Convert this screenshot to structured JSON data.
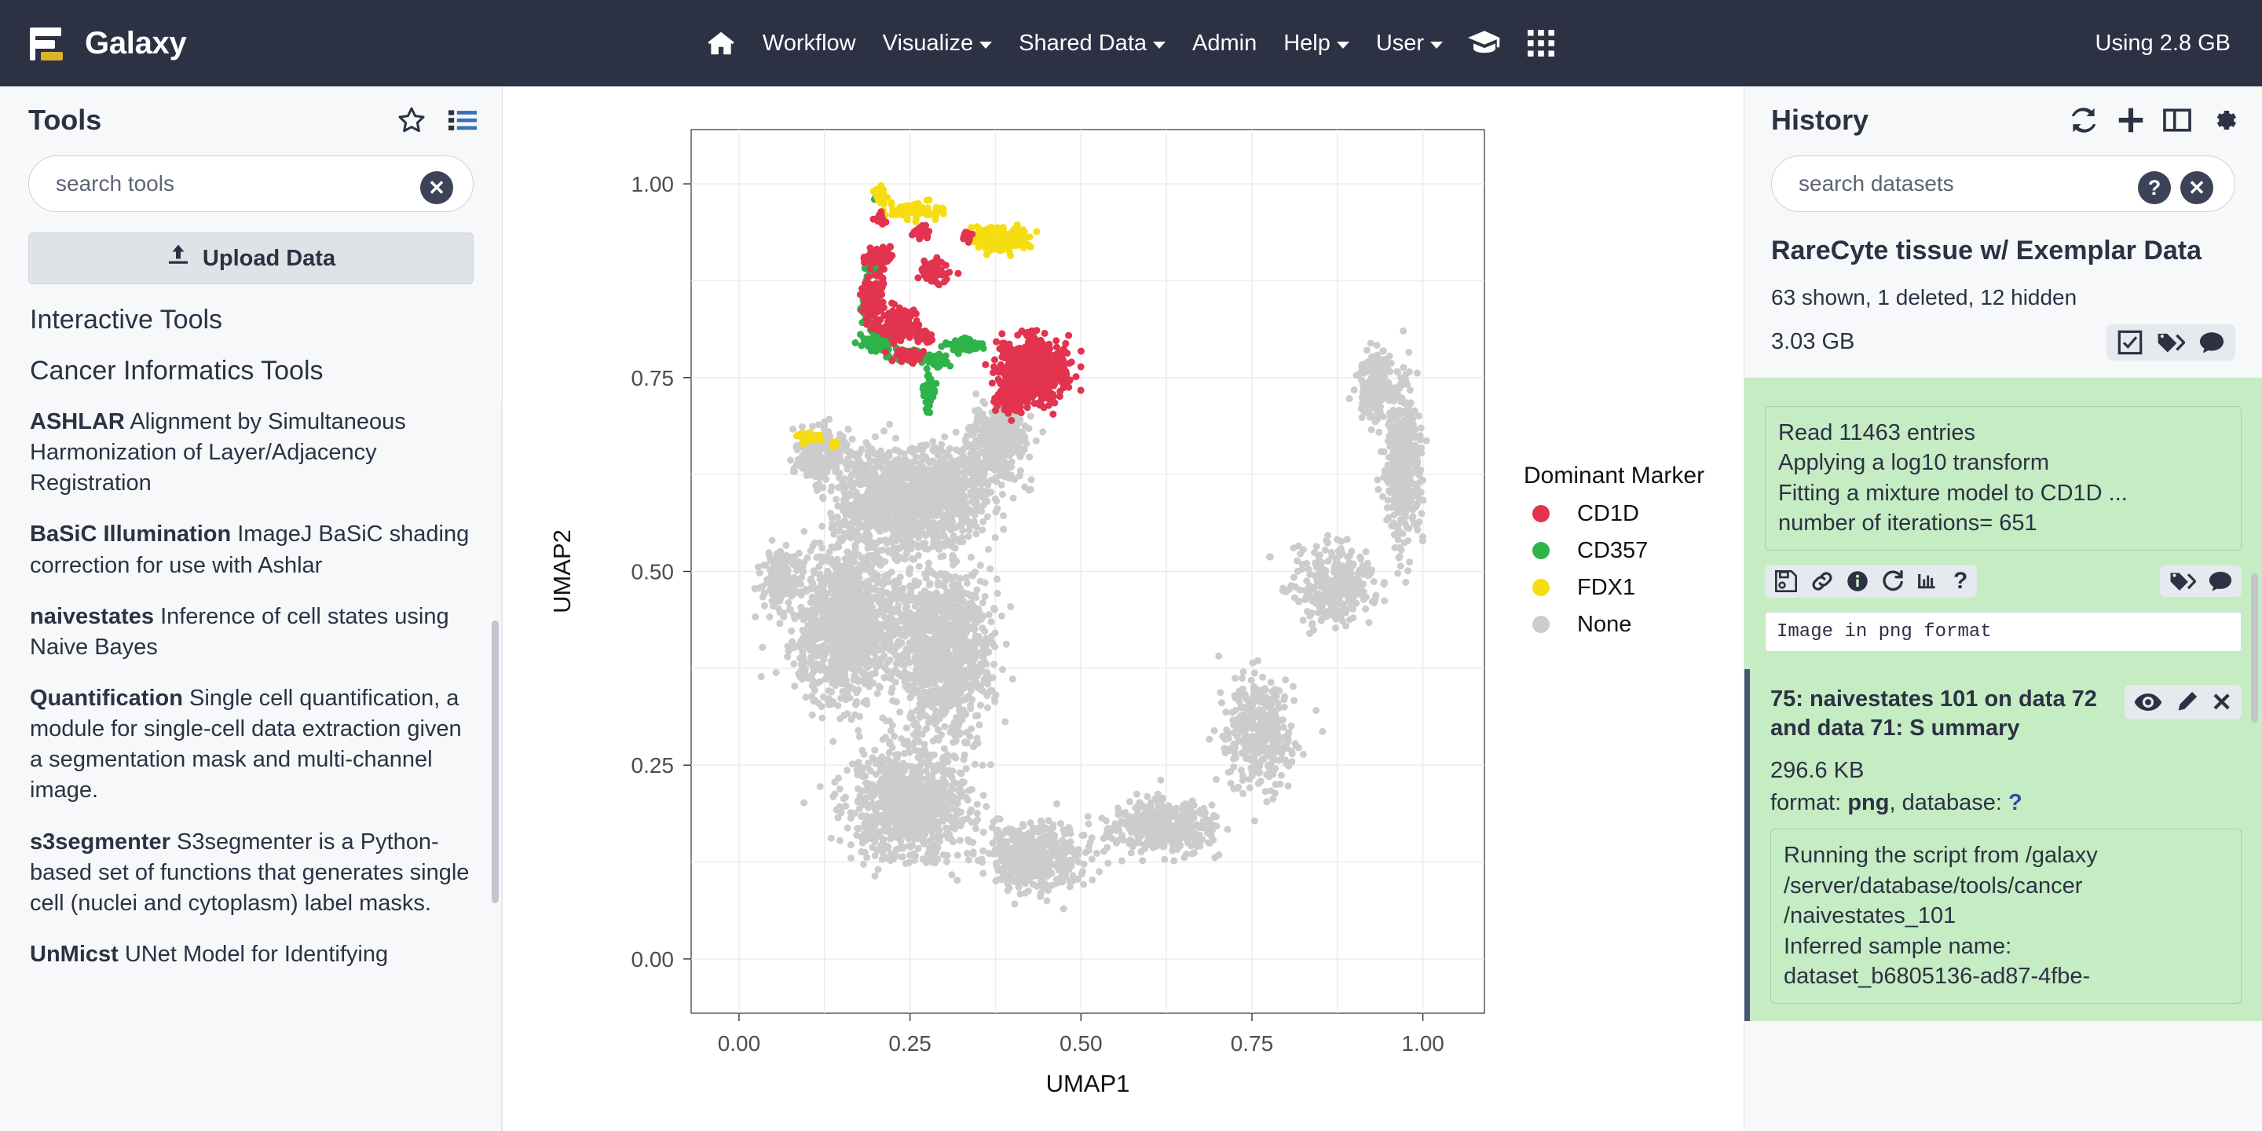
{
  "masthead": {
    "brand": "Galaxy",
    "nav": [
      {
        "name": "home",
        "label": "",
        "icon": "home-icon",
        "caret": false
      },
      {
        "name": "workflow",
        "label": "Workflow",
        "caret": false
      },
      {
        "name": "visualize",
        "label": "Visualize",
        "caret": true
      },
      {
        "name": "shared-data",
        "label": "Shared Data",
        "caret": true
      },
      {
        "name": "admin",
        "label": "Admin",
        "caret": false
      },
      {
        "name": "help",
        "label": "Help",
        "caret": true
      },
      {
        "name": "user",
        "label": "User",
        "caret": true
      }
    ],
    "icons": [
      "graduation-cap-icon",
      "grid-apps-icon"
    ],
    "quota": "Using 2.8 GB"
  },
  "tools": {
    "title": "Tools",
    "favorites_icon": "star-icon",
    "list_icon": "list-icon",
    "search_placeholder": "search tools",
    "search_value": "",
    "clear_icon": "clear-x-icon",
    "upload_label": "Upload Data",
    "upload_icon": "upload-icon",
    "sections": [
      {
        "label": "Interactive Tools"
      },
      {
        "label": "Cancer Informatics Tools"
      }
    ],
    "entries": [
      {
        "name": "ASHLAR",
        "desc": "Alignment by Simultaneous Harmonization of Layer/Adjacency Registration"
      },
      {
        "name": "BaSiC Illumination",
        "desc": "ImageJ BaSiC shading correction for use with Ashlar"
      },
      {
        "name": "naivestates",
        "desc": "Inference of cell states using Naive Bayes"
      },
      {
        "name": "Quantification",
        "desc": "Single cell quantification, a module for single-cell data extraction given a segmentation mask and multi-channel image."
      },
      {
        "name": "s3segmenter",
        "desc": "S3segmenter is a Python-based set of functions that generates single cell (nuclei and cytoplasm) label masks."
      },
      {
        "name": "UnMicst",
        "desc": "UNet Model for Identifying"
      }
    ]
  },
  "history": {
    "title": "History",
    "icons": [
      "refresh-icon",
      "plus-icon",
      "columns-icon",
      "gear-icon"
    ],
    "search_placeholder": "search datasets",
    "search_value": "",
    "help_icon": "help-icon",
    "clear_icon": "clear-x-icon",
    "name": "RareCyte tissue w/ Exemplar Data",
    "counts": "63 shown, 1 deleted, 12 hidden",
    "size": "3.03 GB",
    "toolbar_icons": [
      "select-checkbox-icon",
      "tags-icon",
      "comment-icon"
    ],
    "datasets": [
      {
        "peek_lines": [
          "Read 11463 entries",
          "Applying a log10 transform",
          "Fitting a mixture model to CD1D ...",
          "number of iterations= 651"
        ],
        "action_icons": [
          "save-icon",
          "link-icon",
          "info-icon",
          "rerun-icon",
          "visualize-icon",
          "help-icon"
        ],
        "meta_icons": [
          "tags-icon",
          "comment-icon"
        ],
        "blurb": "Image in png format"
      },
      {
        "title": "75: naivestates 101 on data 72 and data 71: S ummary",
        "action_icons": [
          "eye-icon",
          "pencil-icon",
          "delete-x-icon"
        ],
        "size": "296.6 KB",
        "format_label": "format:",
        "format_value": "png",
        "database_label": ", database:",
        "database_value": "?",
        "peek_lines": [
          "Running the script from /galaxy",
          "/server/database/tools/cancer",
          "/naivestates_101",
          "Inferred sample name:",
          "dataset_b6805136-ad87-4fbe-"
        ]
      }
    ]
  },
  "chart_data": {
    "type": "scatter",
    "title": "",
    "xlabel": "UMAP1",
    "ylabel": "UMAP2",
    "xlim": [
      -0.07,
      1.09
    ],
    "ylim": [
      -0.07,
      1.07
    ],
    "xticks": [
      "0.00",
      "0.25",
      "0.50",
      "0.75",
      "1.00"
    ],
    "xtick_values": [
      0.0,
      0.25,
      0.5,
      0.75,
      1.0
    ],
    "yticks": [
      "0.00",
      "0.25",
      "0.50",
      "0.75",
      "1.00"
    ],
    "ytick_values": [
      0.0,
      0.25,
      0.5,
      0.75,
      1.0
    ],
    "grid": true,
    "legend_title": "Dominant Marker",
    "legend_position": "right",
    "series": [
      {
        "name": "CD1D",
        "color": "#e2334f",
        "n": 1720
      },
      {
        "name": "CD357",
        "color": "#2eb34a",
        "n": 690
      },
      {
        "name": "FDX1",
        "color": "#f6dd11",
        "n": 320
      },
      {
        "name": "None",
        "color": "#cccccc",
        "n": 8733
      }
    ],
    "point_size": 9,
    "clusters": [
      {
        "series": "FDX1",
        "cx": 0.205,
        "cy": 0.985,
        "rx": 0.012,
        "ry": 0.012,
        "n": 25
      },
      {
        "series": "FDX1",
        "cx": 0.255,
        "cy": 0.965,
        "rx": 0.05,
        "ry": 0.012,
        "n": 90
      },
      {
        "series": "FDX1",
        "cx": 0.382,
        "cy": 0.93,
        "rx": 0.052,
        "ry": 0.02,
        "n": 150
      },
      {
        "series": "FDX1",
        "cx": 0.106,
        "cy": 0.672,
        "rx": 0.02,
        "ry": 0.007,
        "n": 35
      },
      {
        "series": "FDX1",
        "cx": 0.14,
        "cy": 0.664,
        "rx": 0.007,
        "ry": 0.005,
        "n": 8
      },
      {
        "series": "CD1D",
        "cx": 0.206,
        "cy": 0.955,
        "rx": 0.01,
        "ry": 0.01,
        "n": 18
      },
      {
        "series": "CD1D",
        "cx": 0.268,
        "cy": 0.938,
        "rx": 0.016,
        "ry": 0.008,
        "n": 30
      },
      {
        "series": "CD1D",
        "cx": 0.334,
        "cy": 0.934,
        "rx": 0.01,
        "ry": 0.008,
        "n": 18
      },
      {
        "series": "CD1D",
        "cx": 0.205,
        "cy": 0.905,
        "rx": 0.024,
        "ry": 0.014,
        "n": 60
      },
      {
        "series": "CD1D",
        "cx": 0.285,
        "cy": 0.888,
        "rx": 0.024,
        "ry": 0.018,
        "n": 70
      },
      {
        "series": "CD1D",
        "cx": 0.196,
        "cy": 0.852,
        "rx": 0.02,
        "ry": 0.035,
        "n": 120
      },
      {
        "series": "CD1D",
        "cx": 0.235,
        "cy": 0.818,
        "rx": 0.032,
        "ry": 0.022,
        "n": 160
      },
      {
        "series": "CD1D",
        "cx": 0.27,
        "cy": 0.805,
        "rx": 0.016,
        "ry": 0.012,
        "n": 50
      },
      {
        "series": "CD1D",
        "cx": 0.248,
        "cy": 0.777,
        "rx": 0.022,
        "ry": 0.01,
        "n": 45
      },
      {
        "series": "CD1D",
        "cx": 0.43,
        "cy": 0.762,
        "rx": 0.056,
        "ry": 0.046,
        "n": 700
      },
      {
        "series": "CD1D",
        "cx": 0.395,
        "cy": 0.723,
        "rx": 0.022,
        "ry": 0.024,
        "n": 120
      },
      {
        "series": "CD357",
        "cx": 0.195,
        "cy": 0.893,
        "rx": 0.01,
        "ry": 0.014,
        "n": 28
      },
      {
        "series": "CD357",
        "cx": 0.19,
        "cy": 0.845,
        "rx": 0.012,
        "ry": 0.03,
        "n": 80
      },
      {
        "series": "CD357",
        "cx": 0.202,
        "cy": 0.795,
        "rx": 0.026,
        "ry": 0.013,
        "n": 80
      },
      {
        "series": "CD357",
        "cx": 0.25,
        "cy": 0.778,
        "rx": 0.03,
        "ry": 0.008,
        "n": 70
      },
      {
        "series": "CD357",
        "cx": 0.29,
        "cy": 0.772,
        "rx": 0.02,
        "ry": 0.01,
        "n": 50
      },
      {
        "series": "CD357",
        "cx": 0.33,
        "cy": 0.792,
        "rx": 0.028,
        "ry": 0.01,
        "n": 70
      },
      {
        "series": "CD357",
        "cx": 0.276,
        "cy": 0.73,
        "rx": 0.008,
        "ry": 0.03,
        "n": 60
      },
      {
        "series": "CD357",
        "cx": 0.205,
        "cy": 0.985,
        "rx": 0.008,
        "ry": 0.008,
        "n": 12
      },
      {
        "series": "None",
        "cx": 0.21,
        "cy": 0.59,
        "rx": 0.09,
        "ry": 0.08,
        "n": 700
      },
      {
        "series": "None",
        "cx": 0.16,
        "cy": 0.43,
        "rx": 0.09,
        "ry": 0.11,
        "n": 1200
      },
      {
        "series": "None",
        "cx": 0.3,
        "cy": 0.4,
        "rx": 0.08,
        "ry": 0.13,
        "n": 1100
      },
      {
        "series": "None",
        "cx": 0.3,
        "cy": 0.6,
        "rx": 0.08,
        "ry": 0.07,
        "n": 600
      },
      {
        "series": "None",
        "cx": 0.38,
        "cy": 0.67,
        "rx": 0.05,
        "ry": 0.06,
        "n": 350
      },
      {
        "series": "None",
        "cx": 0.25,
        "cy": 0.2,
        "rx": 0.11,
        "ry": 0.08,
        "n": 900
      },
      {
        "series": "None",
        "cx": 0.43,
        "cy": 0.13,
        "rx": 0.09,
        "ry": 0.05,
        "n": 450
      },
      {
        "series": "None",
        "cx": 0.62,
        "cy": 0.17,
        "rx": 0.09,
        "ry": 0.04,
        "n": 400
      },
      {
        "series": "None",
        "cx": 0.76,
        "cy": 0.29,
        "rx": 0.06,
        "ry": 0.09,
        "n": 380
      },
      {
        "series": "None",
        "cx": 0.87,
        "cy": 0.48,
        "rx": 0.07,
        "ry": 0.06,
        "n": 300
      },
      {
        "series": "None",
        "cx": 0.97,
        "cy": 0.64,
        "rx": 0.03,
        "ry": 0.12,
        "n": 420
      },
      {
        "series": "None",
        "cx": 0.93,
        "cy": 0.74,
        "rx": 0.03,
        "ry": 0.06,
        "n": 180
      },
      {
        "series": "None",
        "cx": 0.06,
        "cy": 0.49,
        "rx": 0.03,
        "ry": 0.05,
        "n": 160
      },
      {
        "series": "None",
        "cx": 0.12,
        "cy": 0.65,
        "rx": 0.05,
        "ry": 0.04,
        "n": 220
      }
    ]
  }
}
